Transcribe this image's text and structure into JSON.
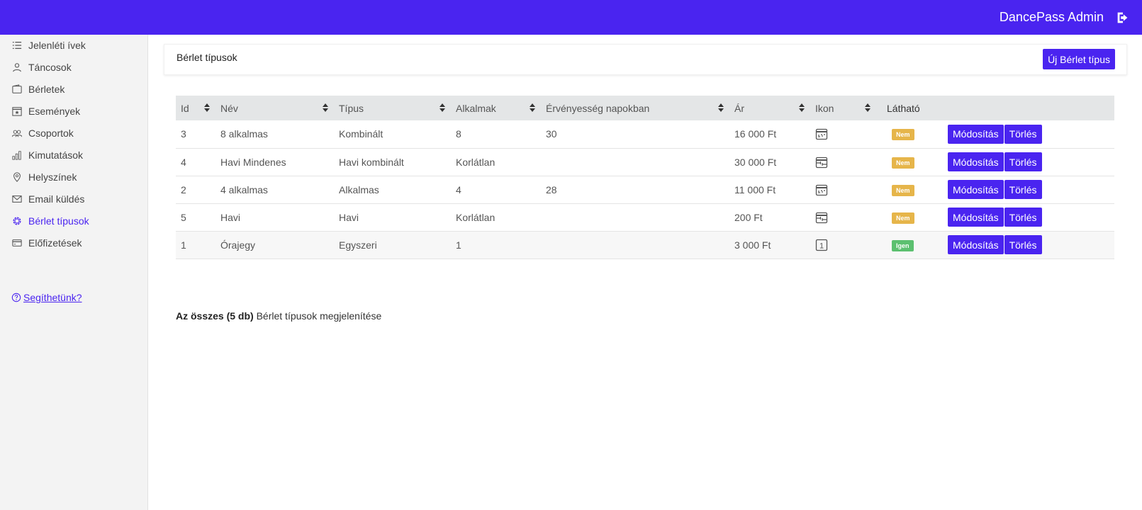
{
  "topbar": {
    "brand": "DancePass Admin",
    "logout_icon": "logout-icon"
  },
  "sidebar": {
    "items": [
      {
        "label": "Jelenléti ívek",
        "icon": "list-icon"
      },
      {
        "label": "Táncosok",
        "icon": "user-icon"
      },
      {
        "label": "Bérletek",
        "icon": "wallet-icon"
      },
      {
        "label": "Események",
        "icon": "calendar-event-icon"
      },
      {
        "label": "Csoportok",
        "icon": "group-icon"
      },
      {
        "label": "Kimutatások",
        "icon": "bar-chart-icon"
      },
      {
        "label": "Helyszínek",
        "icon": "location-pin-icon"
      },
      {
        "label": "Email küldés",
        "icon": "envelope-icon"
      },
      {
        "label": "Bérlet típusok",
        "icon": "gear-icon",
        "active": true
      },
      {
        "label": "Előfizetések",
        "icon": "credit-card-icon"
      }
    ],
    "help": "Segíthetünk?"
  },
  "page": {
    "title": "Bérlet típusok",
    "new_button": "Új Bérlet típus"
  },
  "table": {
    "headers": [
      "Id",
      "Név",
      "Típus",
      "Alkalmak",
      "Érvényesség napokban",
      "Ár",
      "Ikon",
      "Látható"
    ],
    "rows": [
      {
        "id": "3",
        "name": "8 alkalmas",
        "type": "Kombinált",
        "occasions": "8",
        "validity": "30",
        "price": "16 000 Ft",
        "icon": "calendar-week-icon",
        "visible": "Nem"
      },
      {
        "id": "4",
        "name": "Havi Mindenes",
        "type": "Havi kombinált",
        "occasions": "Korlátlan",
        "validity": "",
        "price": "30 000 Ft",
        "icon": "calendar-month-icon",
        "visible": "Nem"
      },
      {
        "id": "2",
        "name": "4 alkalmas",
        "type": "Alkalmas",
        "occasions": "4",
        "validity": "28",
        "price": "11 000 Ft",
        "icon": "calendar-week-icon",
        "visible": "Nem"
      },
      {
        "id": "5",
        "name": "Havi",
        "type": "Havi",
        "occasions": "Korlátlan",
        "validity": "",
        "price": "200 Ft",
        "icon": "calendar-month-icon",
        "visible": "Nem"
      },
      {
        "id": "1",
        "name": "Órajegy",
        "type": "Egyszeri",
        "occasions": "1",
        "validity": "",
        "price": "3 000 Ft",
        "icon": "one-ticket-icon",
        "visible": "Igen"
      }
    ],
    "edit_label": "Módosítás",
    "delete_label": "Törlés"
  },
  "summary": {
    "bold": "Az összes (5 db)",
    "rest": "Bérlet típusok megjelenítése"
  },
  "colors": {
    "primary": "#4a24f0",
    "badge_no": "#e6b54a",
    "badge_yes": "#5cc070"
  }
}
